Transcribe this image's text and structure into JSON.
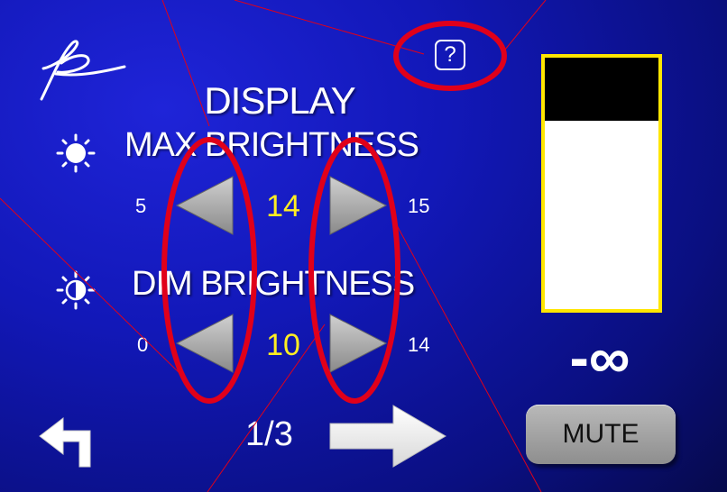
{
  "header": {
    "title": "DISPLAY",
    "help_label": "?"
  },
  "max_brightness": {
    "label": "MAX BRIGHTNESS",
    "min": "5",
    "value": "14",
    "max": "15"
  },
  "dim_brightness": {
    "label": "DIM BRIGHTNESS",
    "min": "0",
    "value": "10",
    "max": "14"
  },
  "level_meter": {
    "readout": "-∞",
    "dark_fraction": 0.25
  },
  "footer": {
    "page_indicator": "1/3",
    "mute_label": "MUTE"
  },
  "colors": {
    "background": "#1218b8",
    "value_text": "#ffee22",
    "meter_border": "#ffe600",
    "annotation_red": "#e0001a"
  },
  "icons": [
    "signature-logo",
    "help-icon",
    "sun-icon",
    "half-sun-icon",
    "left-arrow-icon",
    "right-arrow-icon",
    "back-arrow-icon",
    "next-arrow-icon"
  ]
}
